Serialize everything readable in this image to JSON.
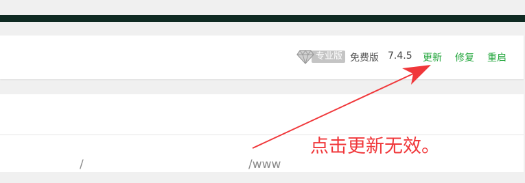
{
  "header": {
    "pro_badge": {
      "icon": "diamond-icon",
      "label": "专业版"
    },
    "edition_label": "免费版",
    "version": "7.4.5",
    "actions": {
      "update": "更新",
      "repair": "修复",
      "restart": "重启"
    }
  },
  "content": {
    "path_root": "/",
    "path_www": "/www"
  },
  "annotation": {
    "text": "点击更新无效。"
  },
  "colors": {
    "top_bar": "#0f2a22",
    "action_link": "#20a53a",
    "annotation": "#f0373a",
    "pro_badge_bg": "#c4c4c4"
  }
}
